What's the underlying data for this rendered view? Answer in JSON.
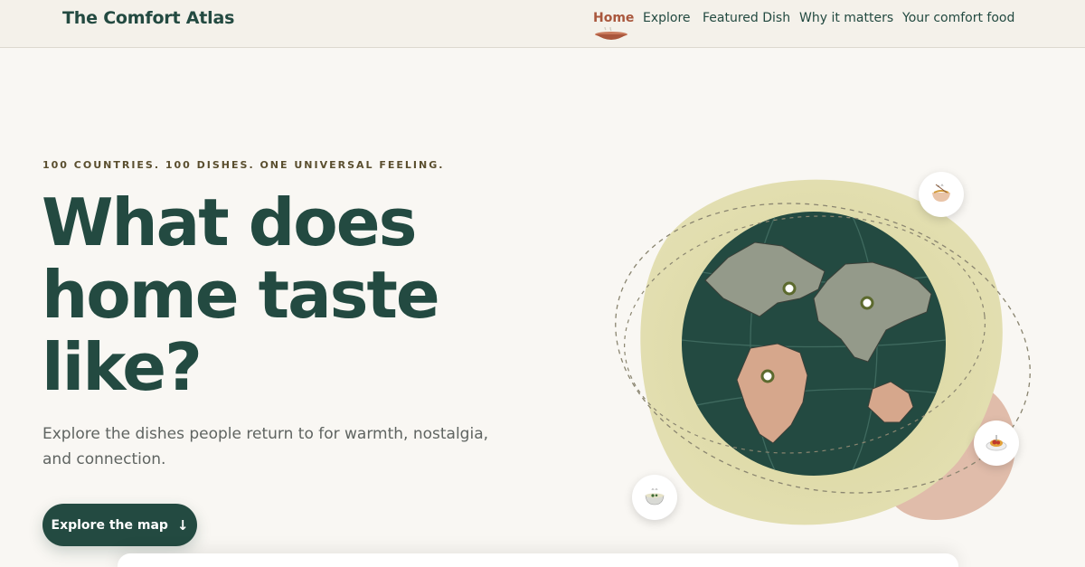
{
  "header": {
    "brand": "The Comfort Atlas",
    "nav": [
      {
        "label": "Home",
        "active": true
      },
      {
        "label": "Explore",
        "active": false
      },
      {
        "label": "Featured Dish",
        "active": false
      },
      {
        "label": "Why it matters",
        "active": false
      },
      {
        "label": "Your comfort food",
        "active": false
      }
    ]
  },
  "hero": {
    "eyebrow": "100 COUNTRIES. 100 DISHES. ONE UNIVERSAL FEELING.",
    "headline_line1": "What does",
    "headline_line2": "home taste",
    "headline_line3": "like?",
    "subtitle_line1": "Explore the dishes people return to for warmth, nostalgia,",
    "subtitle_line2": "and connection.",
    "cta_label": "Explore the map",
    "cta_icon": "arrow-down-icon"
  },
  "illustration": {
    "icons": [
      "globe-icon",
      "noodle-bowl-icon",
      "spaghetti-plate-icon",
      "soup-bowl-icon",
      "location-pin-icon"
    ]
  },
  "colors": {
    "primary": "#234a41",
    "accent": "#a9573d",
    "blob_yellow": "#e0dcae",
    "blob_pink": "#e0bcaa",
    "land_gray": "#949a8a",
    "land_pink": "#d6a78c",
    "background": "#f9f7f3"
  }
}
